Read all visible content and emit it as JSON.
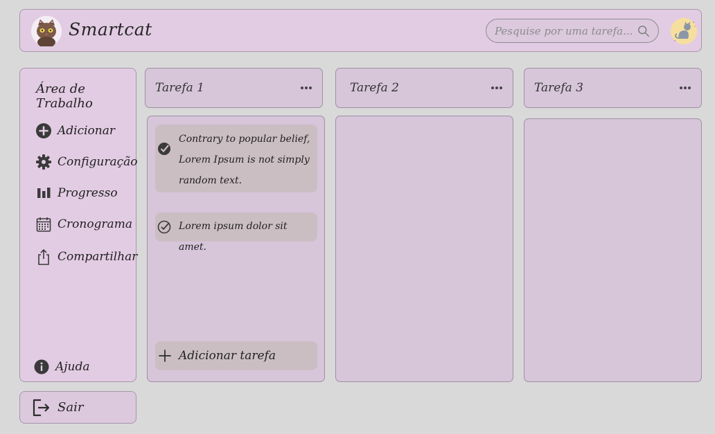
{
  "header": {
    "brand": "Smartcat",
    "search_placeholder": "Pesquise por uma tarefa...",
    "logo_icon": "cat-face-icon",
    "avatar_icon": "cat-avatar-icon"
  },
  "sidebar": {
    "title": "Área de Trabalho",
    "items": [
      {
        "label": "Adicionar",
        "icon": "plus-circle-icon"
      },
      {
        "label": "Configuração",
        "icon": "gear-icon"
      },
      {
        "label": "Progresso",
        "icon": "bar-chart-icon"
      },
      {
        "label": "Cronograma",
        "icon": "calendar-icon"
      },
      {
        "label": "Compartilhar",
        "icon": "share-icon"
      }
    ],
    "help_label": "Ajuda",
    "logout_label": "Sair"
  },
  "columns": [
    {
      "title": "Tarefa 1"
    },
    {
      "title": "Tarefa 2"
    },
    {
      "title": "Tarefa 3"
    }
  ],
  "tasks": [
    {
      "text": "Contrary to popular belief, Lorem Ipsum is not simply random text.",
      "done": true
    },
    {
      "text": "Lorem ipsum dolor sit amet.",
      "done": false
    }
  ],
  "add_task_label": "Adicionar tarefa",
  "colors": {
    "background": "#d9d9d9",
    "panel": "#e2cce3",
    "column": "#d7c5da",
    "card": "#cbbec3"
  }
}
